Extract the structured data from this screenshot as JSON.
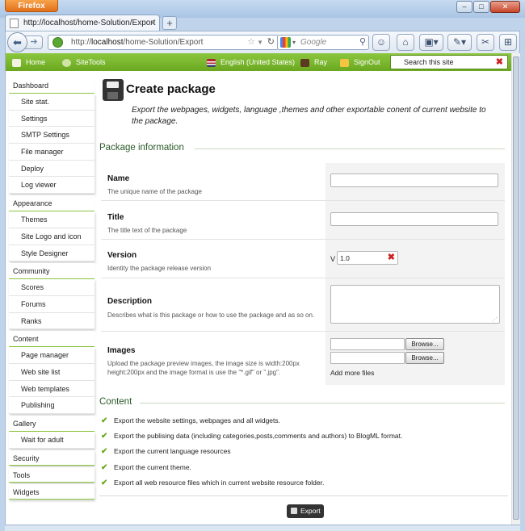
{
  "browser": {
    "app_button": "Firefox",
    "window_controls": {
      "minimize": "–",
      "maximize": "□",
      "close": "✕"
    },
    "tab_title": "http://localhost/home-Solution/Export",
    "tab_close": "×",
    "new_tab": "+",
    "url_prefix": "http://",
    "url_host": "localhost",
    "url_path": "/home-Solution/Export",
    "search_placeholder": "Google"
  },
  "sitebar": {
    "home": "Home",
    "sitetools": "SiteTools",
    "language": "English (United States)",
    "user": "Ray",
    "signout": "SignOut",
    "search_placeholder": "Search this site"
  },
  "sidebar": {
    "dashboard": {
      "title": "Dashboard",
      "items": [
        "Site stat.",
        "Settings",
        "SMTP Settings",
        "File manager",
        "Deploy",
        "Log viewer"
      ]
    },
    "appearance": {
      "title": "Appearance",
      "items": [
        "Themes",
        "Site Logo and icon",
        "Style Designer"
      ]
    },
    "community": {
      "title": "Community",
      "items": [
        "Scores",
        "Forums",
        "Ranks"
      ]
    },
    "content": {
      "title": "Content",
      "items": [
        "Page manager",
        "Web site list",
        "Web templates",
        "Publishing"
      ]
    },
    "gallery": {
      "title": "Gallery",
      "items": [
        "Wait for adult"
      ]
    },
    "security": {
      "title": "Security"
    },
    "tools": {
      "title": "Tools"
    },
    "widgets": {
      "title": "Widgets"
    }
  },
  "main": {
    "title": "Create package",
    "description": "Export the webpages, widgets, language ,themes and other exportable conent of current website to the package.",
    "section_package": "Package information",
    "name_label": "Name",
    "name_hint": "The unique name of the package",
    "title_label": "Title",
    "title_hint": "The title text of the package",
    "version_label": "Version",
    "version_hint": "Identity the package release version",
    "version_prefix": "V",
    "version_value": "1.0",
    "description_label": "Description",
    "description_hint": "Describes what is this package or how to use the package and as so on.",
    "images_label": "Images",
    "images_hint": "Upload the package preview images, the image size is width:200px height:200px and the image format is use the \"*.gif\" or \".jpg\".",
    "browse_label": "Browse...",
    "add_more_files": "Add more files",
    "section_content": "Content",
    "content_items": [
      "Export the website settings, webpages and all widgets.",
      "Export the publising data (including categories,posts,comments and authors) to BlogML format.",
      "Export the current language resources",
      "Export the current theme.",
      "Export all web resource files which in current website resource folder."
    ],
    "export_button": "Export"
  },
  "colors": {
    "accent_green": "#6aa820",
    "window_blue": "#bfd3ea"
  }
}
